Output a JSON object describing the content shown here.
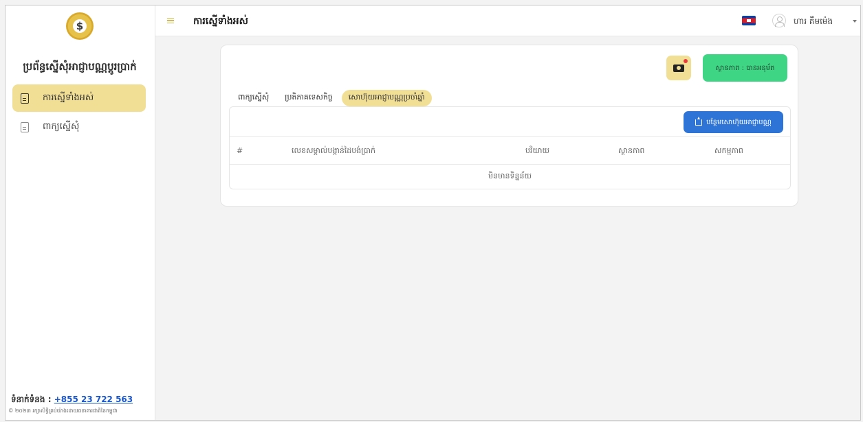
{
  "sidebar": {
    "logo_text": "$",
    "app_title": "ប្រព័ន្ធស្នើសុំអាជ្ញាបណ្ណប្តូរប្រាក់",
    "items": [
      {
        "label": "ការស្នើទាំងអស់",
        "icon": "document-icon",
        "active": true
      },
      {
        "label": "ពាក្យស្នើសុំ",
        "icon": "document-add-icon",
        "active": false
      }
    ],
    "contact_label": "ទំនាក់ទំនង :",
    "contact_phone": "+855 23 722 563",
    "copyright": "© ២០២៣ រក្សាសិទ្ធិគ្រប់យ៉ាងដោយធនាគារជាតិនៃកម្ពុជា"
  },
  "header": {
    "menu_icon": "menu-icon",
    "title": "ការស្នើទាំងអស់",
    "flag_icon": "cambodia-flag-icon",
    "user_name": "ហារ គឹមម៉េង"
  },
  "card": {
    "camera_icon": "camera-icon",
    "status_badge": "ស្ថានភាព : បានអនុម័ត",
    "tabs": [
      {
        "label": "ពាក្យស្នើសុំ",
        "active": false
      },
      {
        "label": "ប្រតិភាគទេសកិច្ច",
        "active": false
      },
      {
        "label": "សោហ៊ុយអាជ្ញាបណ្ណប្រចាំឆ្នាំ",
        "active": true
      }
    ],
    "upload_button": "បន្ថែមសោហ៊ុយអាជ្ញាបណ្ណ",
    "table": {
      "columns": [
        "#",
        "លេខសម្គាល់បង្កាន់ដៃបង់ប្រាក់",
        "បរិយាយ",
        "ស្ថានភាព",
        "សកម្មភាព"
      ],
      "empty_text": "មិនមានទិន្នន័យ"
    }
  },
  "colors": {
    "accent_yellow": "#f2df96",
    "status_green": "#3ed685",
    "button_blue": "#2d74d6",
    "link_blue": "#1a56c7"
  }
}
